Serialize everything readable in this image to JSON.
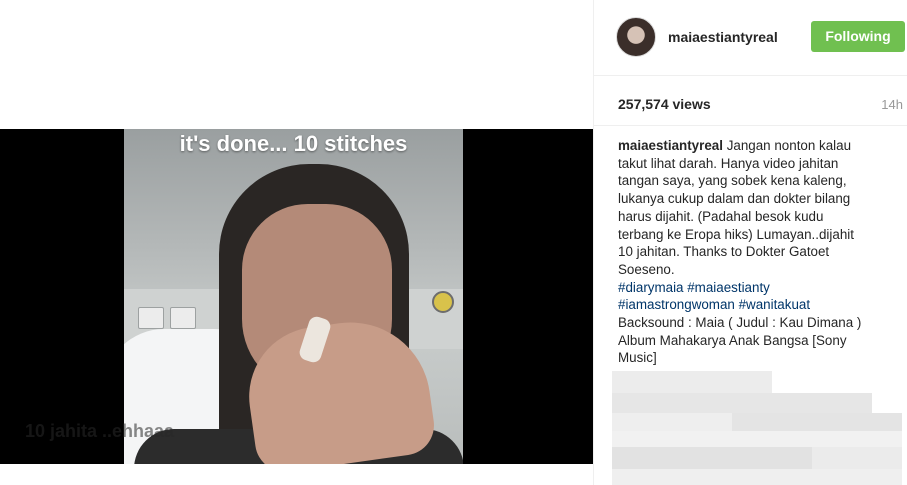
{
  "video": {
    "overlay_text": "it's done... 10 stitches",
    "watermark_text": "10 jahita    ..ehhaaa"
  },
  "header": {
    "username": "maiaestiantyreal",
    "follow_button_label": "Following",
    "follow_button_color": "#70c050"
  },
  "stats": {
    "views": "257,574 views",
    "posted_ago": "14h"
  },
  "caption": {
    "author": "maiaestiantyreal",
    "lines": [
      "Jangan nonton kalau",
      "takut lihat darah. Hanya video jahitan",
      "tangan saya, yang sobek kena kaleng,",
      "lukanya cukup dalam dan dokter bilang",
      "harus dijahit. (Padahal besok kudu",
      "terbang ke Eropa hiks) Lumayan..dijahit",
      "10 jahitan. Thanks to Dokter Gatoet",
      "Soeseno."
    ],
    "hashtag_line_1": [
      "#diarymaia",
      "#maiaestianty"
    ],
    "hashtag_line_2": [
      "#iamastrongwoman",
      "#wanitakuat"
    ],
    "backsound_lines": [
      "Backsound : Maia ( Judul : Kau Dimana )",
      "Album Mahakarya Anak Bangsa [Sony",
      "Music]"
    ]
  },
  "colors": {
    "hashtag": "#003569",
    "text": "#262626",
    "muted": "#999999"
  }
}
